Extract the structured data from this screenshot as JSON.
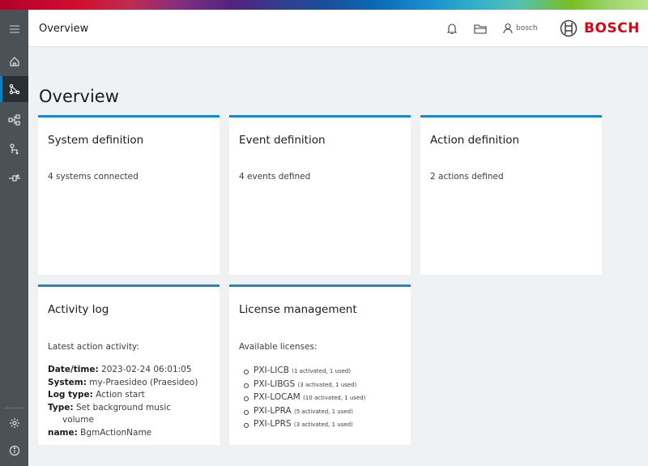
{
  "header": {
    "title": "Overview",
    "user": "bosch",
    "brand": "BOSCH"
  },
  "sidebar": {
    "items": [
      {
        "icon": "menu-icon"
      },
      {
        "icon": "home-icon"
      },
      {
        "icon": "system-topology-icon",
        "active": true
      },
      {
        "icon": "event-tree-icon"
      },
      {
        "icon": "action-flow-icon"
      },
      {
        "icon": "connector-icon"
      }
    ],
    "bottom": [
      {
        "icon": "gear-icon"
      },
      {
        "icon": "info-icon"
      }
    ]
  },
  "page": {
    "title": "Overview"
  },
  "cards": {
    "system": {
      "title": "System definition",
      "text": "4 systems connected"
    },
    "event": {
      "title": "Event definition",
      "text": "4 events defined"
    },
    "action": {
      "title": "Action definition",
      "text": "2 actions defined"
    },
    "activity": {
      "title": "Activity log",
      "subtitle": "Latest action activity:",
      "rows": [
        {
          "label": "Date/time:",
          "value": "2023-02-24 06:01:05"
        },
        {
          "label": "System:",
          "value": "my-Praesideo (Praesideo)"
        },
        {
          "label": "Log type:",
          "value": "Action start"
        },
        {
          "label": "Type:",
          "value": "Set background music",
          "cont": "volume"
        },
        {
          "label": "name:",
          "value": "BgmActionName"
        }
      ]
    },
    "license": {
      "title": "License management",
      "subtitle": "Available licenses:",
      "items": [
        {
          "name": "PXI-LICB",
          "detail": "(1 activated, 1 used)"
        },
        {
          "name": "PXI-LIBGS",
          "detail": "(3 activated, 1 used)"
        },
        {
          "name": "PXI-LOCAM",
          "detail": "(10 activated, 1 used)"
        },
        {
          "name": "PXI-LPRA",
          "detail": "(5 activated, 1 used)"
        },
        {
          "name": "PXI-LPRS",
          "detail": "(3 activated, 1 used)"
        }
      ]
    }
  },
  "colors": {
    "accent": "#1e87cc",
    "sidebar": "#4b5257",
    "brand_red": "#e20015"
  }
}
